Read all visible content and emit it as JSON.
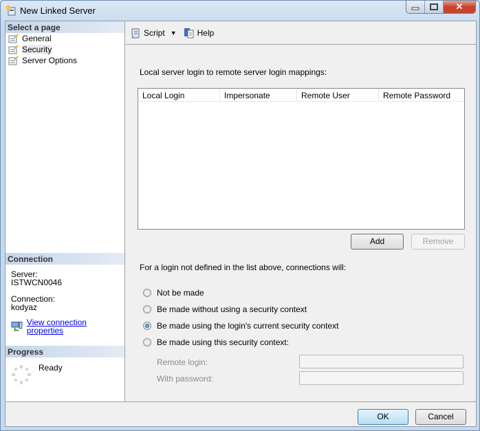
{
  "window": {
    "title": "New Linked Server",
    "icon": "linked-server-icon"
  },
  "window_controls": {
    "minimize": "minimize-icon",
    "maximize": "maximize-icon",
    "close": "close-icon"
  },
  "sidebar": {
    "header": "Select a page",
    "items": [
      {
        "label": "General",
        "selected": false
      },
      {
        "label": "Security",
        "selected": true
      },
      {
        "label": "Server Options",
        "selected": false
      }
    ]
  },
  "connection": {
    "header": "Connection",
    "server_label": "Server:",
    "server_value": "ISTWCN0046",
    "connection_label": "Connection:",
    "connection_value": "kodyaz",
    "link": "View connection properties"
  },
  "progress": {
    "header": "Progress",
    "status": "Ready"
  },
  "toolbar": {
    "script": "Script",
    "help": "Help"
  },
  "main": {
    "mappings_label": "Local server login to remote server login mappings:",
    "columns": [
      "Local Login",
      "Impersonate",
      "Remote User",
      "Remote Password"
    ],
    "rows": [],
    "add_button": "Add",
    "remove_button": "Remove",
    "connections_label": "For a login not defined in the list above, connections will:",
    "options": [
      {
        "label": "Not be made",
        "selected": false
      },
      {
        "label": "Be made without using a security context",
        "selected": false
      },
      {
        "label": "Be made using the login's current security context",
        "selected": true
      },
      {
        "label": "Be made using this security context:",
        "selected": false
      }
    ],
    "remote_login_label": "Remote login:",
    "remote_login_value": "",
    "password_label": "With password:",
    "password_value": ""
  },
  "footer": {
    "ok": "OK",
    "cancel": "Cancel"
  }
}
